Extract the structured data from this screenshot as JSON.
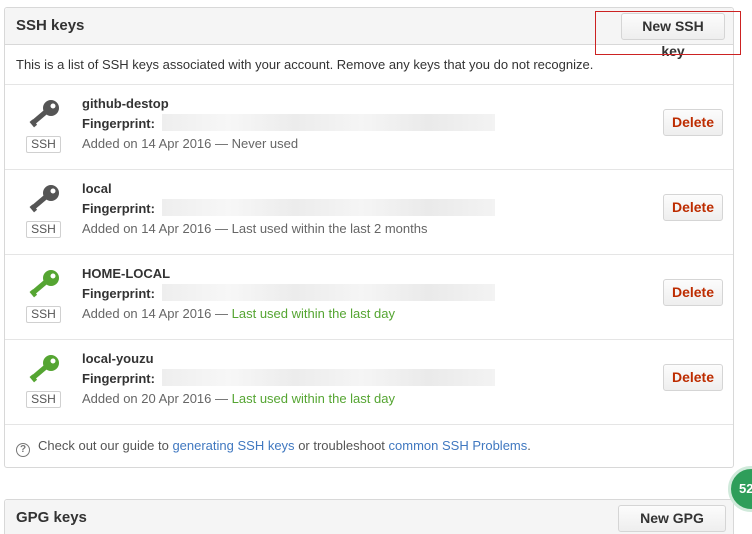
{
  "ssh_panel": {
    "title": "SSH keys",
    "new_button": "New SSH key",
    "intro": "This is a list of SSH keys associated with your account. Remove any keys that you do not recognize.",
    "keys": [
      {
        "title": "github-destop",
        "fingerprint_label": "Fingerprint:",
        "added": "Added on 14 Apr 2016 —",
        "used": "Never used",
        "badge": "SSH",
        "icon_color": "#555555",
        "delete": "Delete"
      },
      {
        "title": "local",
        "fingerprint_label": "Fingerprint:",
        "added": "Added on 14 Apr 2016 —",
        "used": "Last used within the last 2 months",
        "badge": "SSH",
        "icon_color": "#555555",
        "delete": "Delete"
      },
      {
        "title": "HOME-LOCAL",
        "fingerprint_label": "Fingerprint:",
        "added": "Added on 14 Apr 2016 —",
        "used": "Last used within the last day",
        "badge": "SSH",
        "icon_color": "#55a532",
        "delete": "Delete"
      },
      {
        "title": "local-youzu",
        "fingerprint_label": "Fingerprint:",
        "added": "Added on 20 Apr 2016 —",
        "used": "Last used within the last day",
        "badge": "SSH",
        "icon_color": "#55a532",
        "delete": "Delete"
      }
    ],
    "help": {
      "icon": "question-icon",
      "prefix": "Check out our guide to",
      "link1": "generating SSH keys",
      "middle": "or troubleshoot",
      "link2": "common SSH Problems",
      "suffix": "."
    }
  },
  "gpg_panel": {
    "title": "GPG keys",
    "new_button": "New GPG key"
  },
  "floating_badge": {
    "text": "52"
  },
  "colors": {
    "accent_link": "#4078c0",
    "danger": "#bd2c00",
    "recent_used": "#55a532",
    "highlight_box": "#cc2222"
  }
}
